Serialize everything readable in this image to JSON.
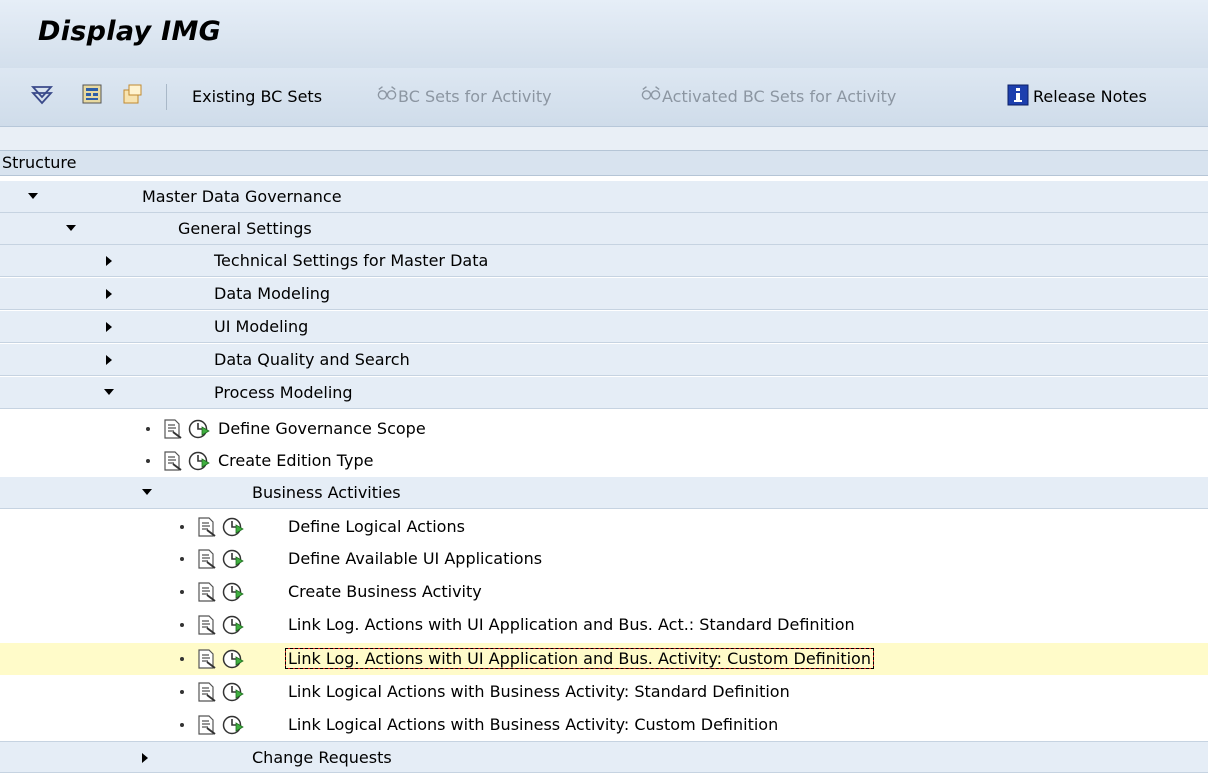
{
  "window": {
    "title": "Display IMG"
  },
  "toolbar": {
    "existing_bc_sets": "Existing BC Sets",
    "bc_sets_for_activity": "BC Sets for Activity",
    "activated_bc_sets": "Activated BC Sets for Activity",
    "release_notes": "Release Notes"
  },
  "tree": {
    "header": "Structure",
    "nodes": [
      {
        "label": "Master Data Governance"
      },
      {
        "label": "General Settings"
      },
      {
        "label": "Technical Settings for Master Data"
      },
      {
        "label": "Data Modeling"
      },
      {
        "label": "UI Modeling"
      },
      {
        "label": "Data Quality and Search"
      },
      {
        "label": "Process Modeling"
      },
      {
        "label": "Define Governance Scope"
      },
      {
        "label": "Create Edition Type"
      },
      {
        "label": "Business Activities"
      },
      {
        "label": "Define Logical Actions"
      },
      {
        "label": "Define Available UI Applications"
      },
      {
        "label": "Create Business Activity"
      },
      {
        "label": "Link Log. Actions with UI Application and Bus. Act.: Standard Definition"
      },
      {
        "label": "Link Log. Actions with UI Application and Bus. Activity: Custom Definition"
      },
      {
        "label": "Link Logical Actions with Business Activity: Standard Definition"
      },
      {
        "label": "Link Logical Actions with Business Activity: Custom Definition"
      },
      {
        "label": "Change Requests"
      }
    ]
  }
}
